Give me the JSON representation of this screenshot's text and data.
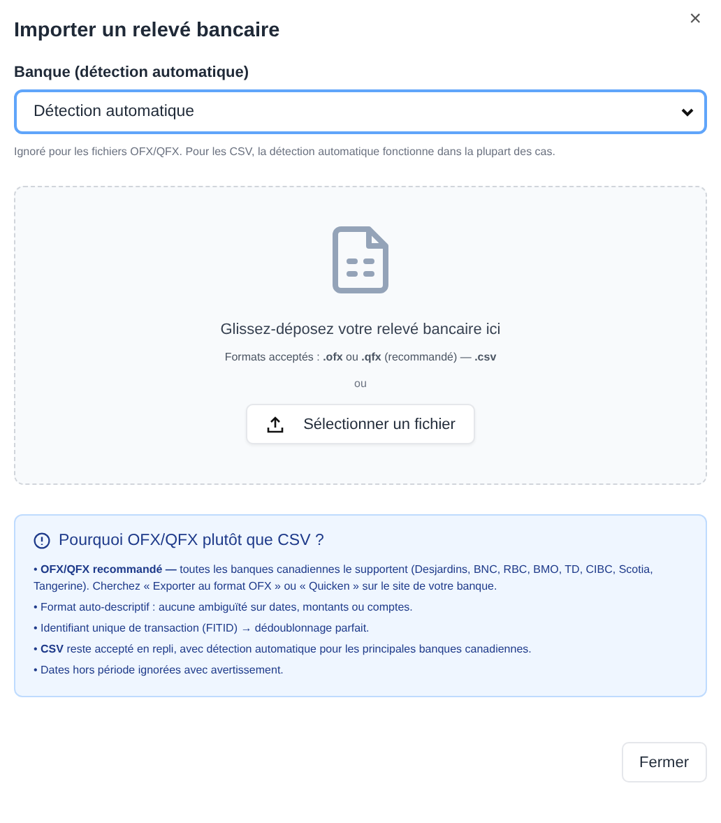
{
  "dialog": {
    "title": "Importer un relevé bancaire",
    "close": "×"
  },
  "bank_field": {
    "label": "Banque (détection automatique)",
    "value": "Détection automatique",
    "hint": "Ignoré pour les fichiers OFX/QFX. Pour les CSV, la détection automatique fonctionne dans la plupart des cas."
  },
  "dropzone": {
    "message": "Glissez-déposez votre relevé bancaire ici",
    "formats": "Formats acceptés : **.ofx** ou **.qfx** (recommandé) — **.csv**",
    "separator": "ou",
    "button": "Sélectionner un fichier"
  },
  "info": {
    "title": "Pourquoi OFX/QFX plutôt que CSV ?",
    "items": [
      "• **OFX/QFX recommandé —** toutes les banques canadiennes le supportent (Desjardins, BNC, RBC, BMO, TD, CIBC, Scotia, Tangerine). Cherchez « Exporter au format OFX » ou « Quicken » sur le site de votre banque.",
      "• Format auto-descriptif : aucune ambiguïté sur dates, montants ou comptes.",
      "• Identifiant unique de transaction (FITID) → dédoublonnage parfait.",
      "• **CSV** reste accepté en repli, avec détection automatique pour les principales banques canadiennes.",
      "• Dates hors période ignorées avec avertissement."
    ]
  },
  "footer": {
    "button": "Fermer"
  }
}
